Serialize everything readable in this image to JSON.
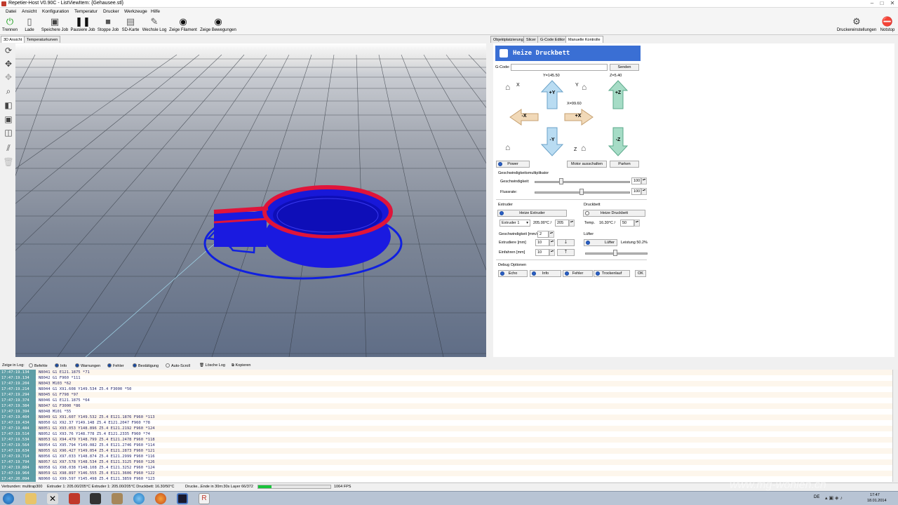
{
  "window": {
    "title": "Repetier-Host V0.90C - ListViewItem: {Gehausee.stl}",
    "controls": [
      "–",
      "□",
      "✕"
    ]
  },
  "menu": [
    "Datei",
    "Ansicht",
    "Konfiguration",
    "Temperatur",
    "Drucker",
    "Werkzeuge",
    "Hilfe"
  ],
  "toolbar": {
    "items": [
      {
        "label": "Trennen",
        "icon": "power-icon"
      },
      {
        "label": "Lade",
        "icon": "file-icon"
      },
      {
        "label": "Speichere Job",
        "icon": "save-icon"
      },
      {
        "label": "Pausiere Job",
        "icon": "pause-icon"
      },
      {
        "label": "Stoppe Job",
        "icon": "stop-icon"
      },
      {
        "label": "SD-Karte",
        "icon": "sd-card-icon"
      },
      {
        "label": "Wechsle Log",
        "icon": "pencil-icon"
      },
      {
        "label": "Zeige Filament",
        "icon": "eye-icon"
      },
      {
        "label": "Zeige Bewegungen",
        "icon": "eye-icon"
      }
    ],
    "right_items": [
      {
        "label": "Druckereinstellungen",
        "icon": "gears-icon"
      },
      {
        "label": "Notstop",
        "icon": "emergency-stop-icon"
      }
    ]
  },
  "left_tabs": [
    "3D Ansicht",
    "Temperaturkurven"
  ],
  "right_tabs": [
    "Objektplatzierung",
    "Slicer",
    "G-Code Editor",
    "Manuelle Kontrolle"
  ],
  "manual": {
    "banner": "Heize Druckbett",
    "gcode_label": "G-Code:",
    "gcode_value": "",
    "send_label": "Senden",
    "y_readout": "Y=145.50",
    "z_readout": "Z=5.40",
    "x_readout": "X=99.60",
    "x_home": "X",
    "y_home": "Y",
    "z_home": "Z",
    "plus_y": "+Y",
    "minus_y": "-Y",
    "plus_x": "+X",
    "minus_x": "-X",
    "plus_z": "+Z",
    "minus_z": "-Z",
    "power_label": "Power",
    "motor_off_label": "Motor ausschalten",
    "park_label": "Parken",
    "speed_section": "Geschwindigkeitsmultiplikator",
    "speed_label": "Geschwindigkeit:",
    "speed_value": "100",
    "speed_level": 0.25,
    "flow_label": "Flussrate:",
    "flow_value": "100",
    "flow_level": 0.49,
    "extruder_section": "Extruder",
    "heat_extruder_label": "Heize Extruder",
    "extruder_select": "Extruder 1",
    "extruder_temp": "205.00°C /",
    "extruder_target": "205",
    "speed_mm_label": "Geschwindigkeit [mm/s]:",
    "speed_mm_value": "2",
    "extrude_label": "Extrudiere [mm]",
    "extrude_value": "10",
    "retract_label": "Einfahren [mm]",
    "retract_value": "10",
    "bed_section": "Druckbett",
    "heat_bed_label": "Heize Druckbett",
    "bed_temp_label": "Temp.",
    "bed_temp": "16.30°C /",
    "bed_target": "50",
    "fan_section": "Lüfter",
    "fan_label": "Lüfter",
    "fan_power": "Leistung 50.2%",
    "fan_level": 0.5,
    "debug_section": "Debug Optionen",
    "debug_buttons": [
      "Echo",
      "Info",
      "Fehler",
      "Trockenlauf"
    ],
    "ok_label": "OK"
  },
  "logbar": {
    "show_label": "Zeige in Log:",
    "options": [
      "Befehle",
      "Info",
      "Warnungen",
      "Fehler",
      "Bestätigung",
      "Auto-Scroll"
    ],
    "clear_label": "Lösche Log",
    "copy_label": "Kopieren"
  },
  "log": [
    {
      "t": "17:47:19.134",
      "c": "N8041 G1 E121.1875 *71"
    },
    {
      "t": "17:47:19.134",
      "c": "N8042 G1 F960 *111"
    },
    {
      "t": "17:47:19.204",
      "c": "N8043 M103 *62"
    },
    {
      "t": "17:47:19.214",
      "c": "N8044 G1 X91.608 Y149.534 Z5.4 F3000 *50"
    },
    {
      "t": "17:47:19.294",
      "c": "N8045 G1 F798 *97"
    },
    {
      "t": "17:47:19.374",
      "c": "N8046 G1 E121.1875 *64"
    },
    {
      "t": "17:47:19.384",
      "c": "N8047 G1 F3000 *86"
    },
    {
      "t": "17:47:19.394",
      "c": "N8048 M101 *55"
    },
    {
      "t": "17:47:19.404",
      "c": "N8049 G1 X91.607 Y149.532 Z5.4 E121.1876 F960 *113"
    },
    {
      "t": "17:47:19.434",
      "c": "N8050 G1 X92.37 Y149.148 Z5.4 E121.2047 F960 *78"
    },
    {
      "t": "17:47:19.484",
      "c": "N8051 G1 X93.053 Y148.896 Z5.4 E121.2192 F960 *124"
    },
    {
      "t": "17:47:19.514",
      "c": "N8052 G1 X93.76 Y148.778 Z5.4 E121.2335 F960 *74"
    },
    {
      "t": "17:47:19.534",
      "c": "N8053 G1 X94.479 Y148.799 Z5.4 E121.2478 F960 *118"
    },
    {
      "t": "17:47:19.564",
      "c": "N8054 G1 X95.794 Y149.082 Z5.4 E121.2746 F960 *114"
    },
    {
      "t": "17:47:19.634",
      "c": "N8055 G1 X96.427 Y149.054 Z5.4 E121.2873 F960 *121"
    },
    {
      "t": "17:47:19.714",
      "c": "N8056 G1 X97.033 Y148.874 Z5.4 E121.2999 F960 *116"
    },
    {
      "t": "17:47:19.794",
      "c": "N8057 G1 X97.578 Y148.534 Z5.4 E121.3125 F960 *126"
    },
    {
      "t": "17:47:19.884",
      "c": "N8058 G1 X98.038 Y148.108 Z5.4 E121.3252 F960 *124"
    },
    {
      "t": "17:47:19.964",
      "c": "N8059 G1 X98.897 Y146.555 Z5.4 E121.3606 F960 *122"
    },
    {
      "t": "17:47:20.094",
      "c": "N8060 G1 X99.597 Y145.498 Z5.4 E121.3859 F960 *123"
    }
  ],
  "status": {
    "connection": "Verbunden: multirap300",
    "temps": "Extruder 1: 205.00/205°C Extruder 1: 205.00/205°C Druckbett: 16.30/50°C",
    "job": "Drucke...Ende in 30m:30s Layer 66/372",
    "progress": 0.18,
    "fps": "1064 FPS"
  },
  "clock": {
    "time": "17:47",
    "date": "18.01.2014"
  },
  "tray_lang": "DE",
  "watermark": "www.mg-wohlen.ch",
  "colors": {
    "accent": "#3a6fd4",
    "log_timestamp": "#5e9ea6",
    "progress": "#19c43b"
  }
}
